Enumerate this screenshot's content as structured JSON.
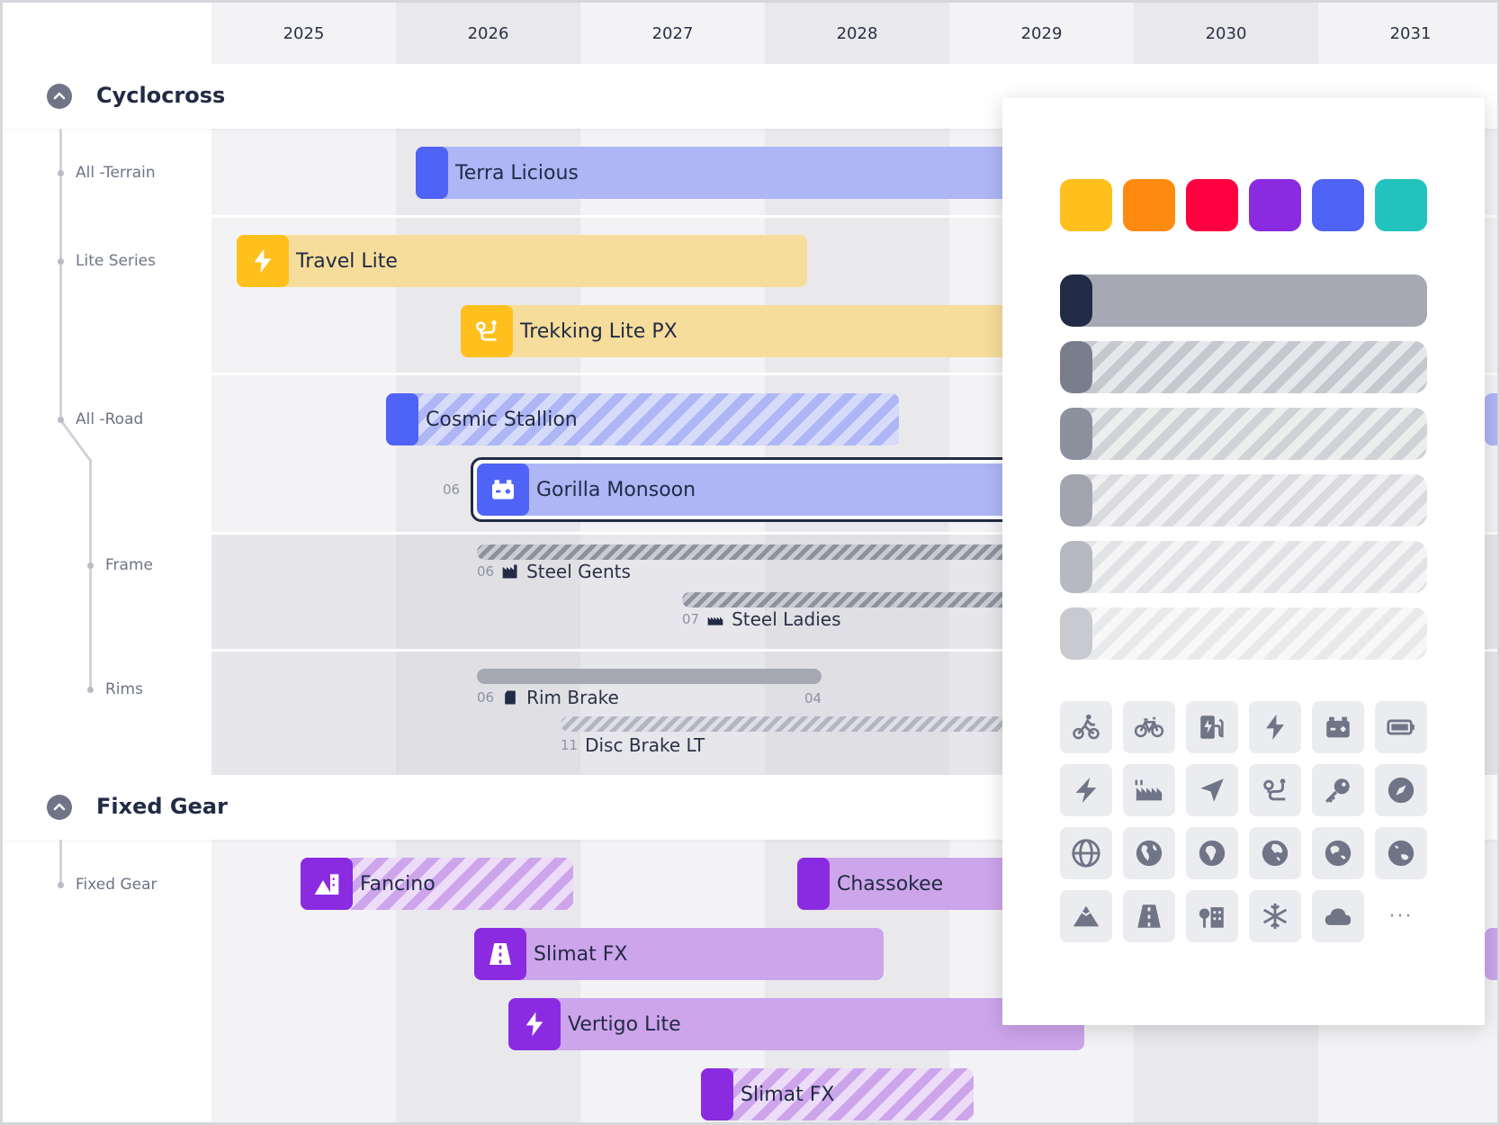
{
  "years": [
    "2025",
    "2026",
    "2027",
    "2028",
    "2029",
    "2030",
    "2031"
  ],
  "groups": {
    "cyclocross": {
      "label": "Cyclocross"
    },
    "fixed_gear": {
      "label": "Fixed Gear"
    }
  },
  "rows": {
    "all_terrain": "All -Terrain",
    "lite_series": "Lite Series",
    "all_road": "All -Road",
    "frame": "Frame",
    "rims": "Rims",
    "fixed_gear": "Fixed Gear"
  },
  "bars": {
    "terra_licious": "Terra Licious",
    "travel_lite": "Travel Lite",
    "trekking_lite_px": "Trekking Lite PX",
    "cosmic_stallion": "Cosmic Stallion",
    "gorilla_monsoon": "Gorilla Monsoon",
    "gorilla_monsoon_start": "06",
    "fancino": "Fancino",
    "chassokee": "Chassokee",
    "slimat_fx": "Slimat FX",
    "vertigo_lite": "Vertigo Lite",
    "slimat_fx_2": "Slimat FX"
  },
  "components": {
    "steel_gents": {
      "label": "Steel Gents",
      "start": "06"
    },
    "steel_ladies": {
      "label": "Steel Ladies",
      "start": "07"
    },
    "rim_brake": {
      "label": "Rim Brake",
      "start": "06",
      "end": "04"
    },
    "disc_brake_lt": {
      "label": "Disc Brake LT",
      "start": "11"
    }
  },
  "popup": {
    "colors": [
      "#ffc01e",
      "#ff8a10",
      "#ff0040",
      "#8a2be2",
      "#4f63f6",
      "#23c3bd"
    ],
    "styles": [
      "solid",
      "hatch-1",
      "hatch-2",
      "hatch-3",
      "hatch-4",
      "hatch-5"
    ],
    "icons": [
      "bike-rider-icon",
      "bicycle-icon",
      "ev-charger-icon",
      "lightning-icon",
      "battery-plus-icon",
      "battery-icon",
      "bolt-icon",
      "factory-icon",
      "navigation-arrow-icon",
      "route-icon",
      "key-icon",
      "compass-icon",
      "globe-icon",
      "earth-americas-icon",
      "earth-africa-icon",
      "earth-asia-icon",
      "earth-europe-icon",
      "earth-oceania-icon",
      "mountain-icon",
      "road-icon",
      "city-icon",
      "snowflake-icon",
      "cloud-icon"
    ],
    "more_label": "···"
  },
  "colors": {
    "blue": "#4f63f6",
    "blue_light": "#aeb6f6",
    "yellow": "#ffc01e",
    "yellow_light": "#f7dd9b",
    "purple": "#8a2be2",
    "purple_light": "#cda5eb",
    "gray": "#a6a9b3",
    "navy": "#222b45"
  }
}
